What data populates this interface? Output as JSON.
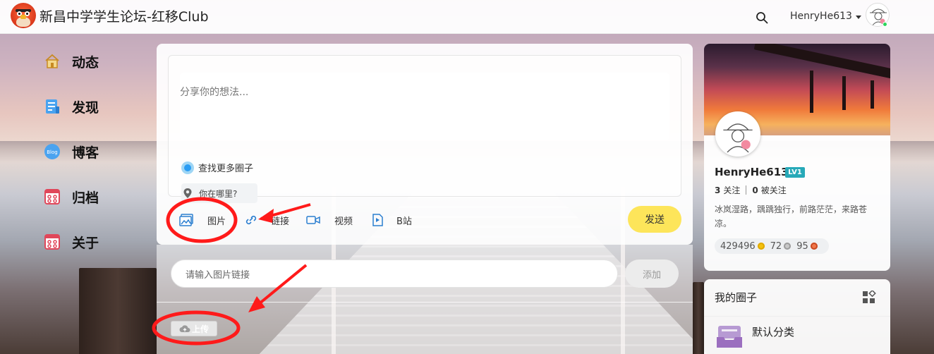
{
  "header": {
    "site_title": "新昌中学学生论坛-红移Club",
    "username": "HenryHe613"
  },
  "nav": [
    {
      "label": "动态",
      "icon": "home-icon"
    },
    {
      "label": "发现",
      "icon": "discover-icon"
    },
    {
      "label": "博客",
      "icon": "blog-icon"
    },
    {
      "label": "归档",
      "icon": "archive-icon"
    },
    {
      "label": "关于",
      "icon": "about-icon"
    }
  ],
  "composer": {
    "placeholder": "分享你的想法...",
    "find_circles": "查找更多圈子",
    "location": "你在哪里?",
    "toolbar": {
      "image": "图片",
      "link": "链接",
      "video": "视频",
      "bilibili": "B站"
    },
    "send": "发送"
  },
  "image_panel": {
    "url_placeholder": "请输入图片链接",
    "add": "添加",
    "upload": "上传"
  },
  "profile": {
    "name": "HenryHe613",
    "level": "LV1",
    "following_count": "3",
    "following_label": "关注",
    "followers_count": "0",
    "followers_label": "被关注",
    "bio": "冰岚湿路，踽踽独行，前路茫茫，来路苍凉。",
    "points": {
      "gold": "429496",
      "silver": "72",
      "bronze": "95"
    },
    "colors": {
      "gold": "#f4c20d",
      "silver": "#b8b8b8",
      "bronze": "#e8643c",
      "level_badge": "#27a9b8"
    }
  },
  "circles": {
    "title": "我的圈子",
    "items": [
      {
        "label": "默认分类",
        "icon": "inbox-tray-icon"
      }
    ]
  },
  "colors": {
    "send_button": "#fde55a",
    "accent_blue": "#2a9df4",
    "annotation_red": "#ff1a1a"
  }
}
